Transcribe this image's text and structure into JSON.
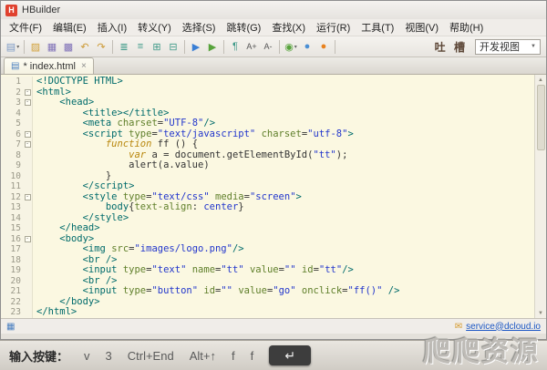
{
  "window": {
    "title": "HBuilder"
  },
  "colors": {
    "editor_bg": "#fbf8e1",
    "logo": "#e0412e",
    "link": "#1a56c4",
    "tag": "#006b6b",
    "string": "#2236cc",
    "keyword": "#b8860b"
  },
  "icons": {
    "logo_letter": "H",
    "file": "▤",
    "close": "×",
    "chevron_down": "▼",
    "scroll_up": "▲",
    "scroll_down": "▼",
    "mail": "✉",
    "panel": "▦",
    "fold_minus": "-"
  },
  "menu": {
    "items": [
      "文件(F)",
      "编辑(E)",
      "插入(I)",
      "转义(Y)",
      "选择(S)",
      "跳转(G)",
      "查找(X)",
      "运行(R)",
      "工具(T)",
      "视图(V)",
      "帮助(H)"
    ]
  },
  "toolbar": {
    "feedback_label": "吐 槽",
    "view_label": "开发视图",
    "icons": [
      {
        "name": "new-file-button",
        "glyph": "▤",
        "color": "#7d9ac6",
        "dropdown": true
      },
      {
        "name": "divider"
      },
      {
        "name": "open-file-button",
        "glyph": "▨",
        "color": "#d2a23c"
      },
      {
        "name": "save-button",
        "glyph": "▦",
        "color": "#8072b8"
      },
      {
        "name": "save-all-button",
        "glyph": "▩",
        "color": "#8072b8"
      },
      {
        "name": "undo-button",
        "glyph": "↶",
        "color": "#cc9933"
      },
      {
        "name": "redo-button",
        "glyph": "↷",
        "color": "#cc9933"
      },
      {
        "name": "divider"
      },
      {
        "name": "format-code-button",
        "glyph": "≣",
        "color": "#3f9a89"
      },
      {
        "name": "outline-button",
        "glyph": "≡",
        "color": "#3f9a89"
      },
      {
        "name": "block-select-button",
        "glyph": "⊞",
        "color": "#3f9a89"
      },
      {
        "name": "word-wrap-button",
        "glyph": "⊟",
        "color": "#3f9a89"
      },
      {
        "name": "divider"
      },
      {
        "name": "run-button",
        "glyph": "▶",
        "color": "#3a7fd5"
      },
      {
        "name": "debug-button",
        "glyph": "▶",
        "color": "#57a33c"
      },
      {
        "name": "divider"
      },
      {
        "name": "paragraph-button",
        "glyph": "¶",
        "color": "#3f9a89"
      },
      {
        "name": "font-increase-button",
        "glyph": "A+",
        "color": "#555555"
      },
      {
        "name": "font-decrease-button",
        "glyph": "A-",
        "color": "#555555"
      },
      {
        "name": "divider"
      },
      {
        "name": "browser-run-select-button",
        "glyph": "◉",
        "color": "#57a33c",
        "dropdown": true
      },
      {
        "name": "chrome-button",
        "glyph": "●",
        "color": "#4a8fd4"
      },
      {
        "name": "firefox-button",
        "glyph": "●",
        "color": "#e8821e"
      },
      {
        "name": "divider"
      }
    ]
  },
  "tabs": {
    "active": {
      "label": "* index.html"
    }
  },
  "editor": {
    "lines": [
      {
        "no": 1,
        "tokens": [
          [
            "t",
            "<!DOCTYPE HTML>"
          ]
        ]
      },
      {
        "no": 2,
        "fold": true,
        "tokens": [
          [
            "t",
            "<html>"
          ]
        ]
      },
      {
        "no": 3,
        "fold": true,
        "tokens": [
          [
            "p",
            "    "
          ],
          [
            "t",
            "<head>"
          ]
        ]
      },
      {
        "no": 4,
        "tokens": [
          [
            "p",
            "        "
          ],
          [
            "t",
            "<title></title>"
          ]
        ]
      },
      {
        "no": 5,
        "tokens": [
          [
            "p",
            "        "
          ],
          [
            "t",
            "<meta "
          ],
          [
            "a",
            "charset"
          ],
          [
            "p",
            "="
          ],
          [
            "s",
            "\"UTF-8\""
          ],
          [
            "t",
            "/>"
          ]
        ]
      },
      {
        "no": 6,
        "fold": true,
        "tokens": [
          [
            "p",
            "        "
          ],
          [
            "t",
            "<script "
          ],
          [
            "a",
            "type"
          ],
          [
            "p",
            "="
          ],
          [
            "s",
            "\"text/javascript\""
          ],
          [
            "p",
            " "
          ],
          [
            "a",
            "charset"
          ],
          [
            "p",
            "="
          ],
          [
            "s",
            "\"utf-8\""
          ],
          [
            "t",
            ">"
          ]
        ]
      },
      {
        "no": 7,
        "fold": true,
        "tokens": [
          [
            "p",
            "            "
          ],
          [
            "k",
            "function"
          ],
          [
            "p",
            " ff () {"
          ]
        ]
      },
      {
        "no": 8,
        "tokens": [
          [
            "p",
            "                "
          ],
          [
            "k",
            "var"
          ],
          [
            "p",
            " a = document.getElementById("
          ],
          [
            "s",
            "\"tt\""
          ],
          [
            "p",
            ");"
          ]
        ]
      },
      {
        "no": 9,
        "tokens": [
          [
            "p",
            "                alert(a.value)"
          ]
        ]
      },
      {
        "no": 10,
        "tokens": [
          [
            "p",
            "            }"
          ]
        ]
      },
      {
        "no": 11,
        "tokens": [
          [
            "p",
            "        "
          ],
          [
            "t",
            "</script>"
          ]
        ]
      },
      {
        "no": 12,
        "fold": true,
        "tokens": [
          [
            "p",
            "        "
          ],
          [
            "t",
            "<style "
          ],
          [
            "a",
            "type"
          ],
          [
            "p",
            "="
          ],
          [
            "s",
            "\"text/css\""
          ],
          [
            "p",
            " "
          ],
          [
            "a",
            "media"
          ],
          [
            "p",
            "="
          ],
          [
            "s",
            "\"screen\""
          ],
          [
            "t",
            ">"
          ]
        ]
      },
      {
        "no": 13,
        "tokens": [
          [
            "p",
            "            "
          ],
          [
            "t",
            "body"
          ],
          [
            "p",
            "{"
          ],
          [
            "a",
            "text-align"
          ],
          [
            "p",
            ": "
          ],
          [
            "s",
            "center"
          ],
          [
            "p",
            "}"
          ]
        ]
      },
      {
        "no": 14,
        "tokens": [
          [
            "p",
            "        "
          ],
          [
            "t",
            "</style>"
          ]
        ]
      },
      {
        "no": 15,
        "tokens": [
          [
            "p",
            "    "
          ],
          [
            "t",
            "</head>"
          ]
        ]
      },
      {
        "no": 16,
        "fold": true,
        "tokens": [
          [
            "p",
            "    "
          ],
          [
            "t",
            "<body>"
          ]
        ]
      },
      {
        "no": 17,
        "tokens": [
          [
            "p",
            "        "
          ],
          [
            "t",
            "<img "
          ],
          [
            "a",
            "src"
          ],
          [
            "p",
            "="
          ],
          [
            "s",
            "\"images/logo.png\""
          ],
          [
            "t",
            "/>"
          ]
        ]
      },
      {
        "no": 18,
        "tokens": [
          [
            "p",
            "        "
          ],
          [
            "t",
            "<br />"
          ]
        ]
      },
      {
        "no": 19,
        "tokens": [
          [
            "p",
            "        "
          ],
          [
            "t",
            "<input "
          ],
          [
            "a",
            "type"
          ],
          [
            "p",
            "="
          ],
          [
            "s",
            "\"text\""
          ],
          [
            "p",
            " "
          ],
          [
            "a",
            "name"
          ],
          [
            "p",
            "="
          ],
          [
            "s",
            "\"tt\""
          ],
          [
            "p",
            " "
          ],
          [
            "a",
            "value"
          ],
          [
            "p",
            "="
          ],
          [
            "s",
            "\"\""
          ],
          [
            "p",
            " "
          ],
          [
            "a",
            "id"
          ],
          [
            "p",
            "="
          ],
          [
            "s",
            "\"tt\""
          ],
          [
            "t",
            "/>"
          ]
        ]
      },
      {
        "no": 20,
        "tokens": [
          [
            "p",
            "        "
          ],
          [
            "t",
            "<br />"
          ]
        ]
      },
      {
        "no": 21,
        "tokens": [
          [
            "p",
            "        "
          ],
          [
            "t",
            "<input "
          ],
          [
            "a",
            "type"
          ],
          [
            "p",
            "="
          ],
          [
            "s",
            "\"button\""
          ],
          [
            "p",
            " "
          ],
          [
            "a",
            "id"
          ],
          [
            "p",
            "="
          ],
          [
            "s",
            "\"\""
          ],
          [
            "p",
            " "
          ],
          [
            "a",
            "value"
          ],
          [
            "p",
            "="
          ],
          [
            "s",
            "\"go\""
          ],
          [
            "p",
            " "
          ],
          [
            "a",
            "onclick"
          ],
          [
            "p",
            "="
          ],
          [
            "s",
            "\"ff()\""
          ],
          [
            "p",
            " "
          ],
          [
            "t",
            "/>"
          ]
        ]
      },
      {
        "no": 22,
        "tokens": [
          [
            "p",
            "    "
          ],
          [
            "t",
            "</body>"
          ]
        ]
      },
      {
        "no": 23,
        "tokens": [
          [
            "t",
            "</html>"
          ]
        ]
      }
    ]
  },
  "statusbar": {
    "link": "service@dcloud.io"
  },
  "keybar": {
    "label": "输入按键：",
    "keys": [
      "v",
      "3",
      "Ctrl+End",
      "Alt+↑",
      "f",
      "f"
    ],
    "enter_glyph": "↵"
  },
  "watermark": {
    "text": "爬爬资源"
  }
}
